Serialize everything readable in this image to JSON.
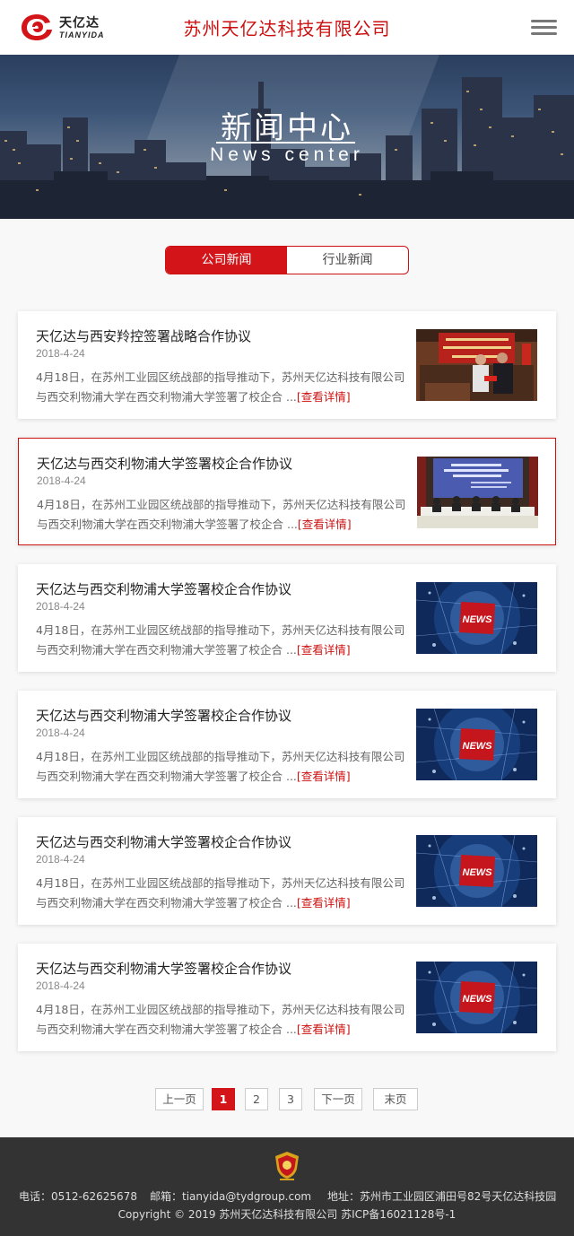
{
  "header": {
    "logo_cn": "天亿达",
    "logo_en": "TIANYIDA",
    "company_name": "苏州天亿达科技有限公司"
  },
  "banner": {
    "title": "新闻中心",
    "subtitle": "News center"
  },
  "tabs": [
    {
      "label": "公司新闻",
      "active": true
    },
    {
      "label": "行业新闻",
      "active": false
    }
  ],
  "news": [
    {
      "title": "天亿达与西安羚控签署战略合作协议",
      "date": "2018-4-24",
      "desc": "4月18日，在苏州工业园区统战部的指导推动下，苏州天亿达科技有限公司与西交利物浦大学在西交利物浦大学签署了校企合 ...",
      "more": "[查看详情]",
      "thumb": "signing-photo"
    },
    {
      "title": "天亿达与西交利物浦大学签署校企合作协议",
      "date": "2018-4-24",
      "desc": "4月18日，在苏州工业园区统战部的指导推动下，苏州天亿达科技有限公司与西交利物浦大学在西交利物浦大学签署了校企合 ...",
      "more": "[查看详情]",
      "thumb": "conference-photo"
    },
    {
      "title": "天亿达与西交利物浦大学签署校企合作协议",
      "date": "2018-4-24",
      "desc": "4月18日，在苏州工业园区统战部的指导推动下，苏州天亿达科技有限公司与西交利物浦大学在西交利物浦大学签署了校企合 ...",
      "more": "[查看详情]",
      "thumb": "news-graphic",
      "thumb_label": "NEWS"
    },
    {
      "title": "天亿达与西交利物浦大学签署校企合作协议",
      "date": "2018-4-24",
      "desc": "4月18日，在苏州工业园区统战部的指导推动下，苏州天亿达科技有限公司与西交利物浦大学在西交利物浦大学签署了校企合 ...",
      "more": "[查看详情]",
      "thumb": "news-graphic",
      "thumb_label": "NEWS"
    },
    {
      "title": "天亿达与西交利物浦大学签署校企合作协议",
      "date": "2018-4-24",
      "desc": "4月18日，在苏州工业园区统战部的指导推动下，苏州天亿达科技有限公司与西交利物浦大学在西交利物浦大学签署了校企合 ...",
      "more": "[查看详情]",
      "thumb": "news-graphic",
      "thumb_label": "NEWS"
    },
    {
      "title": "天亿达与西交利物浦大学签署校企合作协议",
      "date": "2018-4-24",
      "desc": "4月18日，在苏州工业园区统战部的指导推动下，苏州天亿达科技有限公司与西交利物浦大学在西交利物浦大学签署了校企合 ...",
      "more": "[查看详情]",
      "thumb": "news-graphic",
      "thumb_label": "NEWS"
    }
  ],
  "pagination": {
    "prev": "上一页",
    "pages": [
      "1",
      "2",
      "3"
    ],
    "current": "1",
    "next": "下一页",
    "last": "末页"
  },
  "footer": {
    "phone": "电话：0512-62625678",
    "email": "邮箱：tianyida@tydgroup.com",
    "address": "地址：苏州市工业园区浦田号82号天亿达科技园",
    "copyright": "Copyright © 2019 苏州天亿达科技有限公司  苏ICP备16021128号-1"
  },
  "colors": {
    "accent": "#d3151a",
    "footer_bg": "#333333"
  }
}
